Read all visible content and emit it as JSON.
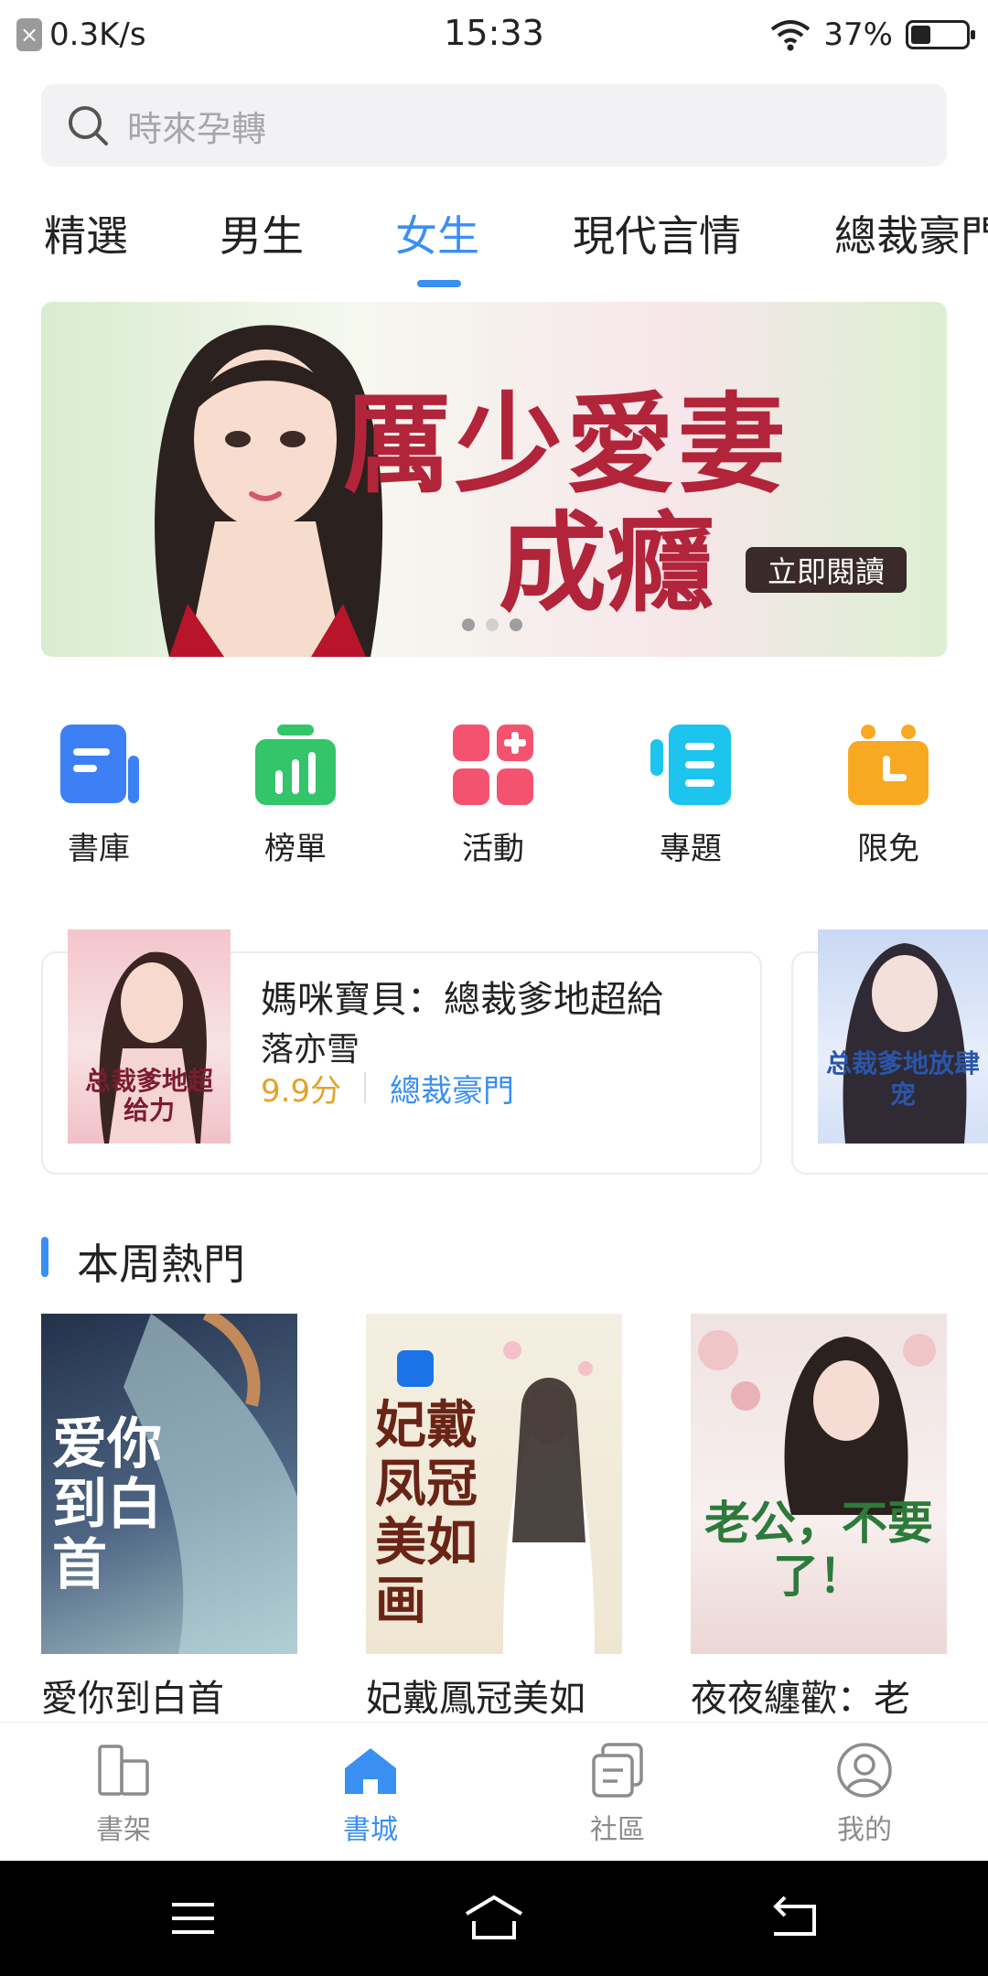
{
  "status_bar": {
    "net_speed": "0.3K/s",
    "time": "15:33",
    "battery": "37%",
    "battery_level": 0.37
  },
  "search": {
    "placeholder": "時來孕轉"
  },
  "tabs": [
    {
      "label": "精選",
      "active": false
    },
    {
      "label": "男生",
      "active": false
    },
    {
      "label": "女生",
      "active": true
    },
    {
      "label": "現代言情",
      "active": false
    },
    {
      "label": "總裁豪門",
      "active": false
    }
  ],
  "banner": {
    "title_line1": "厲少愛妻",
    "title_line2": "成癮",
    "cta": "立即閱讀",
    "dots": 3,
    "active_dot": 1
  },
  "quick_links": [
    {
      "label": "書庫",
      "icon": "book-library-icon",
      "color": "#3d7ff5"
    },
    {
      "label": "榜單",
      "icon": "ranking-icon",
      "color": "#34c46a"
    },
    {
      "label": "活動",
      "icon": "activity-icon",
      "color": "#f3536f"
    },
    {
      "label": "專題",
      "icon": "topic-icon",
      "color": "#1cc4ee"
    },
    {
      "label": "限免",
      "icon": "free-limited-icon",
      "color": "#f8a921"
    }
  ],
  "featured": [
    {
      "title": "媽咪寶貝：總裁爹地超給",
      "author": "落亦雪",
      "score": "9.9分",
      "genre": "總裁豪門",
      "cover_text": "总裁爹地超给力"
    },
    {
      "cover_text": "总裁爹地放肆宠"
    }
  ],
  "section": {
    "title": "本周熱門"
  },
  "weekly_books": [
    {
      "title": "愛你到白首",
      "cover_text": "爱你到白首"
    },
    {
      "title": "妃戴鳳冠美如",
      "cover_text": "妃戴凤冠美如画"
    },
    {
      "title": "夜夜纏歡：老",
      "cover_text": "老公，不要了！"
    }
  ],
  "bottom_nav": [
    {
      "label": "書架",
      "icon": "bookshelf-icon",
      "active": false
    },
    {
      "label": "書城",
      "icon": "bookstore-home-icon",
      "active": true
    },
    {
      "label": "社區",
      "icon": "community-icon",
      "active": false
    },
    {
      "label": "我的",
      "icon": "profile-icon",
      "active": false
    }
  ],
  "colors": {
    "accent": "#3a8ff2",
    "score": "#e3a22a"
  }
}
